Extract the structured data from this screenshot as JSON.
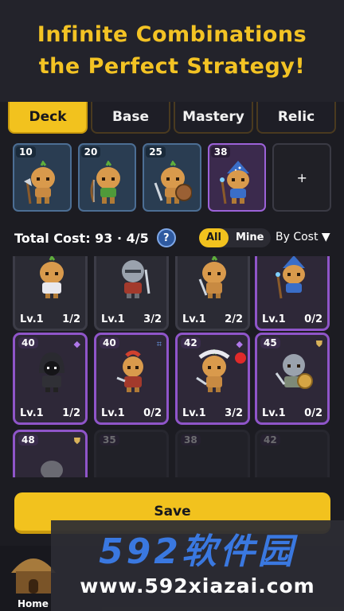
{
  "banner": {
    "line1": "Infinite Combinations",
    "line2": "the Perfect Strategy!"
  },
  "tabs": [
    {
      "label": "Deck",
      "active": true
    },
    {
      "label": "Base",
      "active": false
    },
    {
      "label": "Mastery",
      "active": false
    },
    {
      "label": "Relic",
      "active": false
    }
  ],
  "deck": {
    "slots": [
      {
        "cost": "10",
        "unit": "axe-warrior"
      },
      {
        "cost": "20",
        "unit": "archer"
      },
      {
        "cost": "25",
        "unit": "shield-warrior"
      },
      {
        "cost": "38",
        "unit": "wizard"
      }
    ],
    "add_label": "+"
  },
  "cost_bar": {
    "total_text": "Total Cost: 93 · 4/5",
    "help_label": "?",
    "filter_all": "All",
    "filter_mine": "Mine",
    "sort_label": "By Cost ▼"
  },
  "units": [
    {
      "cost": "",
      "level": "Lv.1",
      "count": "1/2",
      "rarity": "rare",
      "icon": "",
      "new": false
    },
    {
      "cost": "",
      "level": "Lv.1",
      "count": "3/2",
      "rarity": "rare",
      "icon": "",
      "new": true
    },
    {
      "cost": "",
      "level": "Lv.1",
      "count": "2/2",
      "rarity": "rare",
      "icon": "",
      "new": true
    },
    {
      "cost": "",
      "level": "Lv.1",
      "count": "0/2",
      "rarity": "epic",
      "icon": "",
      "new": false
    },
    {
      "cost": "40",
      "level": "Lv.1",
      "count": "1/2",
      "rarity": "epic",
      "icon": "diamond-icon",
      "new": false
    },
    {
      "cost": "40",
      "level": "Lv.1",
      "count": "0/2",
      "rarity": "epic",
      "icon": "frame-icon",
      "new": false
    },
    {
      "cost": "42",
      "level": "Lv.1",
      "count": "3/2",
      "rarity": "epic",
      "icon": "diamond-icon",
      "new": true
    },
    {
      "cost": "45",
      "level": "Lv.1",
      "count": "0/2",
      "rarity": "epic",
      "icon": "shield-icon",
      "new": false
    },
    {
      "cost": "48",
      "level": "",
      "count": "",
      "rarity": "epic",
      "icon": "shield-icon",
      "new": false,
      "locked": false
    },
    {
      "cost": "35",
      "level": "",
      "count": "",
      "rarity": "rare",
      "icon": "",
      "new": false,
      "locked": true
    },
    {
      "cost": "38",
      "level": "",
      "count": "",
      "rarity": "rare",
      "icon": "",
      "new": false,
      "locked": true
    },
    {
      "cost": "42",
      "level": "",
      "count": "",
      "rarity": "rare",
      "icon": "",
      "new": false,
      "locked": true
    }
  ],
  "save_label": "Save",
  "nav": {
    "home_label": "Home"
  },
  "watermark": {
    "big": "592软件园",
    "small": "www.592xiazai.com"
  },
  "colors": {
    "accent": "#f2c21e",
    "epic": "#8f55c9",
    "rare": "#4c6e94",
    "alert": "#e02a2a"
  }
}
